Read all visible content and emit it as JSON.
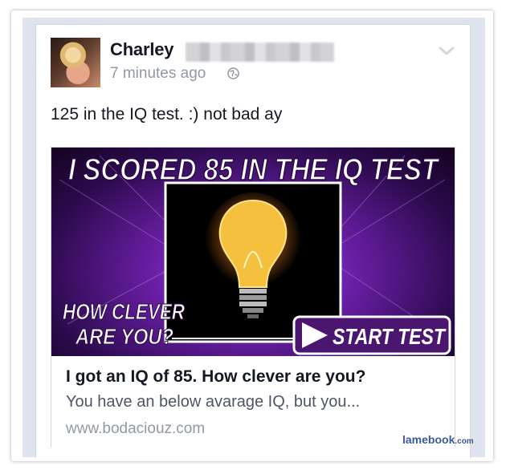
{
  "post": {
    "author": "Charley",
    "timestamp": "7 minutes ago",
    "text": "125 in the IQ test. :) not bad ay"
  },
  "link": {
    "image_headline": "I SCORED 85 IN THE IQ TEST",
    "image_left_line1": "HOW CLEVER",
    "image_left_line2": "ARE YOU?",
    "image_button": "START TEST",
    "title": "I got an IQ of 85. How clever are you?",
    "description": "You have an below avarage IQ, but you...",
    "url": "www.bodaciouz.com"
  },
  "watermark": {
    "brand": "lamebook",
    "domain": ".com"
  },
  "icons": [
    "globe-icon",
    "chevron-down-icon",
    "lightbulb-image",
    "play-icon"
  ],
  "colors": {
    "name": "#141823",
    "meta": "#9197a3",
    "card_border": "#d3d6db",
    "feed_bg": "#dfe3ee",
    "watermark": "#3b5998"
  }
}
